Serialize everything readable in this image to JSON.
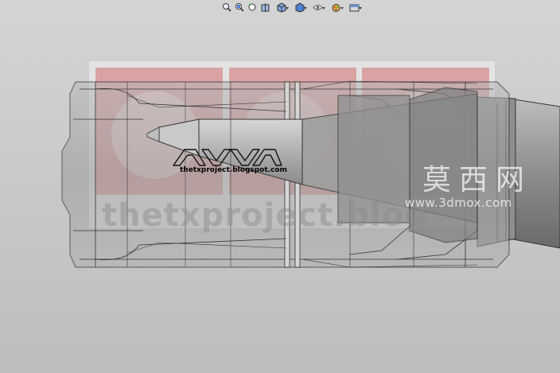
{
  "toolbar": {
    "buttons": [
      {
        "icon": "zoom-to-fit-icon"
      },
      {
        "icon": "zoom-to-area-icon"
      },
      {
        "icon": "previous-view-icon"
      },
      {
        "icon": "section-view-icon"
      },
      {
        "icon": "view-orientation-icon"
      },
      {
        "icon": "display-style-icon"
      },
      {
        "icon": "hide-show-items-icon"
      },
      {
        "icon": "edit-appearance-icon"
      },
      {
        "icon": "apply-scene-icon"
      }
    ]
  },
  "decal": {
    "blog_caption": "thetxproject.blogspot.com",
    "blog_big": "thetxproject.blog"
  },
  "watermark": {
    "cn": "莫西网",
    "url": "www.3dmox.com"
  },
  "colors": {
    "background": "#c9c9c9",
    "decal_red": "#d9a7a7",
    "edge": "#2a2a2a"
  }
}
